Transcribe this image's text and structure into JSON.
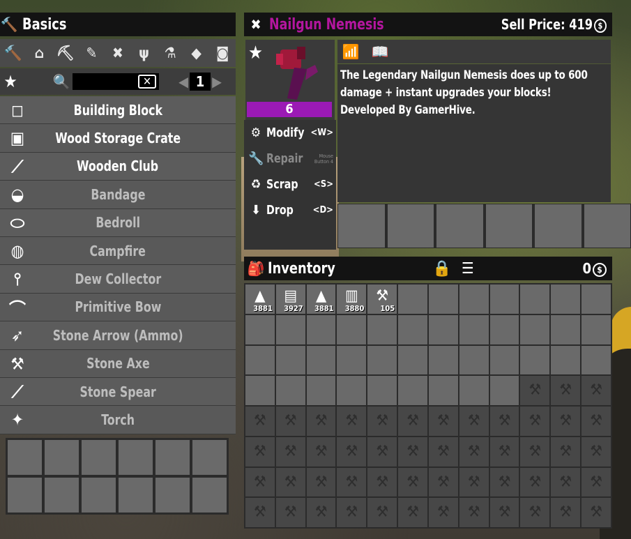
{
  "crafting": {
    "title": "Basics",
    "categories": [
      {
        "name": "hammer-icon",
        "glyph": "🔨"
      },
      {
        "name": "home-icon",
        "glyph": "⌂"
      },
      {
        "name": "building-icon",
        "glyph": "⛏"
      },
      {
        "name": "syringe-icon",
        "glyph": "✎"
      },
      {
        "name": "tools-icon",
        "glyph": "✖"
      },
      {
        "name": "fork-icon",
        "glyph": "ψ"
      },
      {
        "name": "microscope-icon",
        "glyph": "⚗"
      },
      {
        "name": "armor-icon",
        "glyph": "◆"
      },
      {
        "name": "chair-icon",
        "glyph": "◙"
      }
    ],
    "search_placeholder": "",
    "page": "1",
    "recipes": [
      {
        "name": "Building Block",
        "dim": false,
        "thumb": "◻"
      },
      {
        "name": "Wood Storage Crate",
        "dim": false,
        "thumb": "▣"
      },
      {
        "name": "Wooden Club",
        "dim": false,
        "thumb": "⟋"
      },
      {
        "name": "Bandage",
        "dim": true,
        "thumb": "◒"
      },
      {
        "name": "Bedroll",
        "dim": true,
        "thumb": "⬭"
      },
      {
        "name": "Campfire",
        "dim": true,
        "thumb": "◍"
      },
      {
        "name": "Dew Collector",
        "dim": true,
        "thumb": "⫯"
      },
      {
        "name": "Primitive Bow",
        "dim": true,
        "thumb": "⌒"
      },
      {
        "name": "Stone Arrow (Ammo)",
        "dim": true,
        "thumb": "➶"
      },
      {
        "name": "Stone Axe",
        "dim": true,
        "thumb": "⚒"
      },
      {
        "name": "Stone Spear",
        "dim": true,
        "thumb": "⟋"
      },
      {
        "name": "Torch",
        "dim": true,
        "thumb": "✦"
      }
    ]
  },
  "item_info": {
    "title": "Nailgun Nemesis",
    "sell_label": "Sell Price: 419",
    "coin": "$",
    "level": "6",
    "description": "The Legendary Nailgun Nemesis does up to 600 damage + instant upgrades your blocks! Developed By GamerHive.",
    "actions": [
      {
        "label": "Modify",
        "key": "<W>",
        "icon": "⚙",
        "disabled": false
      },
      {
        "label": "Repair",
        "key": "Mouse Button 4",
        "icon": "🔧",
        "disabled": true
      },
      {
        "label": "Scrap",
        "key": "<S>",
        "icon": "♻",
        "disabled": false
      },
      {
        "label": "Drop",
        "key": "<D>",
        "icon": "⬇",
        "disabled": false
      }
    ]
  },
  "inventory": {
    "title": "Inventory",
    "money": "0",
    "items": [
      {
        "slot": 0,
        "count": "3881",
        "icon": "▲"
      },
      {
        "slot": 1,
        "count": "3927",
        "icon": "▤"
      },
      {
        "slot": 2,
        "count": "3881",
        "icon": "▲"
      },
      {
        "slot": 3,
        "count": "3880",
        "icon": "▥"
      },
      {
        "slot": 4,
        "count": "105",
        "icon": "⚒"
      }
    ],
    "unlocked_slots": 45
  }
}
